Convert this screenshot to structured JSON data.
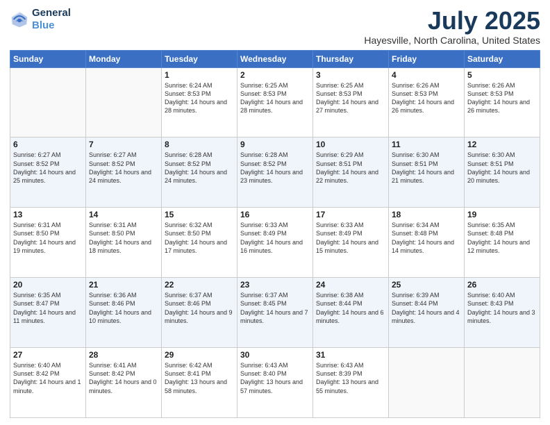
{
  "logo": {
    "line1": "General",
    "line2": "Blue"
  },
  "title": "July 2025",
  "subtitle": "Hayesville, North Carolina, United States",
  "days_of_week": [
    "Sunday",
    "Monday",
    "Tuesday",
    "Wednesday",
    "Thursday",
    "Friday",
    "Saturday"
  ],
  "weeks": [
    [
      {
        "day": "",
        "info": ""
      },
      {
        "day": "",
        "info": ""
      },
      {
        "day": "1",
        "info": "Sunrise: 6:24 AM\nSunset: 8:53 PM\nDaylight: 14 hours and 28 minutes."
      },
      {
        "day": "2",
        "info": "Sunrise: 6:25 AM\nSunset: 8:53 PM\nDaylight: 14 hours and 28 minutes."
      },
      {
        "day": "3",
        "info": "Sunrise: 6:25 AM\nSunset: 8:53 PM\nDaylight: 14 hours and 27 minutes."
      },
      {
        "day": "4",
        "info": "Sunrise: 6:26 AM\nSunset: 8:53 PM\nDaylight: 14 hours and 26 minutes."
      },
      {
        "day": "5",
        "info": "Sunrise: 6:26 AM\nSunset: 8:53 PM\nDaylight: 14 hours and 26 minutes."
      }
    ],
    [
      {
        "day": "6",
        "info": "Sunrise: 6:27 AM\nSunset: 8:52 PM\nDaylight: 14 hours and 25 minutes."
      },
      {
        "day": "7",
        "info": "Sunrise: 6:27 AM\nSunset: 8:52 PM\nDaylight: 14 hours and 24 minutes."
      },
      {
        "day": "8",
        "info": "Sunrise: 6:28 AM\nSunset: 8:52 PM\nDaylight: 14 hours and 24 minutes."
      },
      {
        "day": "9",
        "info": "Sunrise: 6:28 AM\nSunset: 8:52 PM\nDaylight: 14 hours and 23 minutes."
      },
      {
        "day": "10",
        "info": "Sunrise: 6:29 AM\nSunset: 8:51 PM\nDaylight: 14 hours and 22 minutes."
      },
      {
        "day": "11",
        "info": "Sunrise: 6:30 AM\nSunset: 8:51 PM\nDaylight: 14 hours and 21 minutes."
      },
      {
        "day": "12",
        "info": "Sunrise: 6:30 AM\nSunset: 8:51 PM\nDaylight: 14 hours and 20 minutes."
      }
    ],
    [
      {
        "day": "13",
        "info": "Sunrise: 6:31 AM\nSunset: 8:50 PM\nDaylight: 14 hours and 19 minutes."
      },
      {
        "day": "14",
        "info": "Sunrise: 6:31 AM\nSunset: 8:50 PM\nDaylight: 14 hours and 18 minutes."
      },
      {
        "day": "15",
        "info": "Sunrise: 6:32 AM\nSunset: 8:50 PM\nDaylight: 14 hours and 17 minutes."
      },
      {
        "day": "16",
        "info": "Sunrise: 6:33 AM\nSunset: 8:49 PM\nDaylight: 14 hours and 16 minutes."
      },
      {
        "day": "17",
        "info": "Sunrise: 6:33 AM\nSunset: 8:49 PM\nDaylight: 14 hours and 15 minutes."
      },
      {
        "day": "18",
        "info": "Sunrise: 6:34 AM\nSunset: 8:48 PM\nDaylight: 14 hours and 14 minutes."
      },
      {
        "day": "19",
        "info": "Sunrise: 6:35 AM\nSunset: 8:48 PM\nDaylight: 14 hours and 12 minutes."
      }
    ],
    [
      {
        "day": "20",
        "info": "Sunrise: 6:35 AM\nSunset: 8:47 PM\nDaylight: 14 hours and 11 minutes."
      },
      {
        "day": "21",
        "info": "Sunrise: 6:36 AM\nSunset: 8:46 PM\nDaylight: 14 hours and 10 minutes."
      },
      {
        "day": "22",
        "info": "Sunrise: 6:37 AM\nSunset: 8:46 PM\nDaylight: 14 hours and 9 minutes."
      },
      {
        "day": "23",
        "info": "Sunrise: 6:37 AM\nSunset: 8:45 PM\nDaylight: 14 hours and 7 minutes."
      },
      {
        "day": "24",
        "info": "Sunrise: 6:38 AM\nSunset: 8:44 PM\nDaylight: 14 hours and 6 minutes."
      },
      {
        "day": "25",
        "info": "Sunrise: 6:39 AM\nSunset: 8:44 PM\nDaylight: 14 hours and 4 minutes."
      },
      {
        "day": "26",
        "info": "Sunrise: 6:40 AM\nSunset: 8:43 PM\nDaylight: 14 hours and 3 minutes."
      }
    ],
    [
      {
        "day": "27",
        "info": "Sunrise: 6:40 AM\nSunset: 8:42 PM\nDaylight: 14 hours and 1 minute."
      },
      {
        "day": "28",
        "info": "Sunrise: 6:41 AM\nSunset: 8:42 PM\nDaylight: 14 hours and 0 minutes."
      },
      {
        "day": "29",
        "info": "Sunrise: 6:42 AM\nSunset: 8:41 PM\nDaylight: 13 hours and 58 minutes."
      },
      {
        "day": "30",
        "info": "Sunrise: 6:43 AM\nSunset: 8:40 PM\nDaylight: 13 hours and 57 minutes."
      },
      {
        "day": "31",
        "info": "Sunrise: 6:43 AM\nSunset: 8:39 PM\nDaylight: 13 hours and 55 minutes."
      },
      {
        "day": "",
        "info": ""
      },
      {
        "day": "",
        "info": ""
      }
    ]
  ]
}
